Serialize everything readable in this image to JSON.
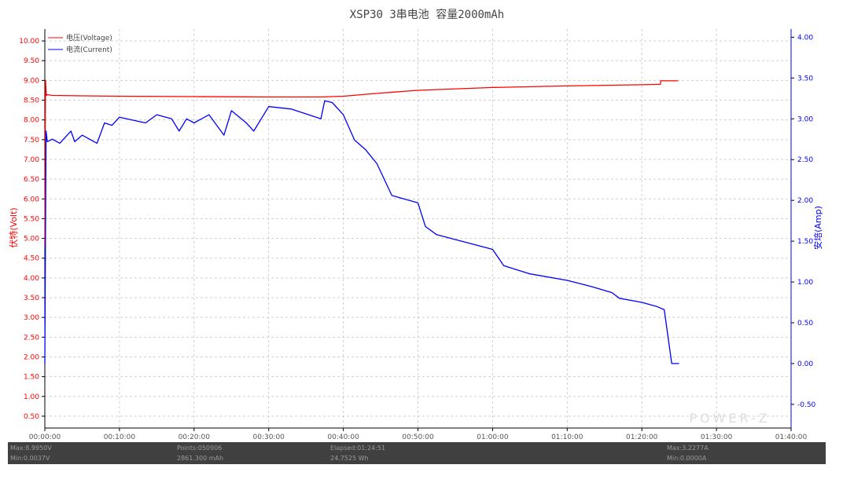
{
  "chart_data": {
    "type": "line",
    "title": "XSP30 3串电池 容量2000mAh",
    "xlabel": "",
    "ylabel_left": "伏特(Volt)",
    "ylabel_right": "安培(Amp)",
    "x_unit": "elapsed time (hh:mm:ss)",
    "xlim": [
      "00:00:00",
      "01:40:00"
    ],
    "x_ticks": [
      "00:00:00",
      "00:10:00",
      "00:20:00",
      "00:30:00",
      "00:40:00",
      "00:50:00",
      "01:00:00",
      "01:10:00",
      "01:20:00",
      "01:30:00",
      "01:40:00"
    ],
    "ylim_left": [
      0.2,
      10.3
    ],
    "y_ticks_left": [
      "0.50",
      "1.00",
      "1.50",
      "2.00",
      "2.50",
      "3.00",
      "3.50",
      "4.00",
      "4.50",
      "5.00",
      "5.50",
      "6.00",
      "6.50",
      "7.00",
      "7.50",
      "8.00",
      "8.50",
      "9.00",
      "9.50",
      "10.00"
    ],
    "ylim_right": [
      -0.79,
      4.1
    ],
    "y_ticks_right": [
      "-0.50",
      "0.00",
      "0.50",
      "1.00",
      "1.50",
      "2.00",
      "2.50",
      "3.00",
      "3.50",
      "4.00"
    ],
    "grid": true,
    "legend_position": "top-left",
    "series": [
      {
        "name": "电压(Voltage)",
        "axis": "left",
        "color": "#ff0000",
        "x": [
          "00:00:00",
          "00:00:06",
          "00:00:12",
          "00:00:20",
          "00:01:00",
          "00:05:00",
          "00:10:00",
          "00:20:00",
          "00:30:00",
          "00:37:00",
          "00:40:00",
          "00:45:00",
          "00:50:00",
          "01:00:00",
          "01:10:00",
          "01:20:00",
          "01:22:30",
          "01:22:31",
          "01:24:51"
        ],
        "y": [
          4.8,
          9.0,
          8.62,
          8.64,
          8.62,
          8.61,
          8.6,
          8.59,
          8.58,
          8.58,
          8.6,
          8.68,
          8.75,
          8.82,
          8.86,
          8.89,
          8.9,
          8.99,
          8.99
        ]
      },
      {
        "name": "电流(Current)",
        "axis": "right",
        "color": "#0000ff",
        "x": [
          "00:00:00",
          "00:00:10",
          "00:00:20",
          "00:01:00",
          "00:02:00",
          "00:03:30",
          "00:04:00",
          "00:05:00",
          "00:07:00",
          "00:08:00",
          "00:09:00",
          "00:10:00",
          "00:13:30",
          "00:15:00",
          "00:17:00",
          "00:18:00",
          "00:19:00",
          "00:20:00",
          "00:22:00",
          "00:24:00",
          "00:25:00",
          "00:27:00",
          "00:28:00",
          "00:30:00",
          "00:33:00",
          "00:37:00",
          "00:37:30",
          "00:38:30",
          "00:40:00",
          "00:41:30",
          "00:43:00",
          "00:44:30",
          "00:46:30",
          "00:50:00",
          "00:51:00",
          "00:52:30",
          "01:00:00",
          "01:01:30",
          "01:05:00",
          "01:10:00",
          "01:13:00",
          "01:16:00",
          "01:17:00",
          "01:20:00",
          "01:22:00",
          "01:23:00",
          "01:24:00",
          "01:25:00"
        ],
        "y": [
          0.0,
          2.85,
          2.72,
          2.75,
          2.7,
          2.85,
          2.72,
          2.8,
          2.7,
          2.95,
          2.92,
          3.02,
          2.95,
          3.05,
          3.0,
          2.85,
          3.0,
          2.95,
          3.05,
          2.8,
          3.1,
          2.95,
          2.85,
          3.15,
          3.12,
          3.0,
          3.22,
          3.2,
          3.05,
          2.74,
          2.62,
          2.45,
          2.06,
          1.97,
          1.68,
          1.58,
          1.4,
          1.2,
          1.1,
          1.02,
          0.95,
          0.87,
          0.8,
          0.75,
          0.7,
          0.66,
          0.0,
          0.0
        ]
      }
    ]
  },
  "legend": {
    "voltage_label": "电压(Voltage)",
    "current_label": "电流(Current)"
  },
  "watermark": "POWER-Z",
  "status_bar": {
    "max_voltage": "Max:8.9950V",
    "min_voltage": "Min:0.0037V",
    "points": "Points:050906",
    "capacity": "2861.300 mAh",
    "elapsed": "Elapsed:01:24:51",
    "energy": "24.7525 Wh",
    "max_current": "Max:3.2277A",
    "min_current": "Min:0.0000A"
  }
}
